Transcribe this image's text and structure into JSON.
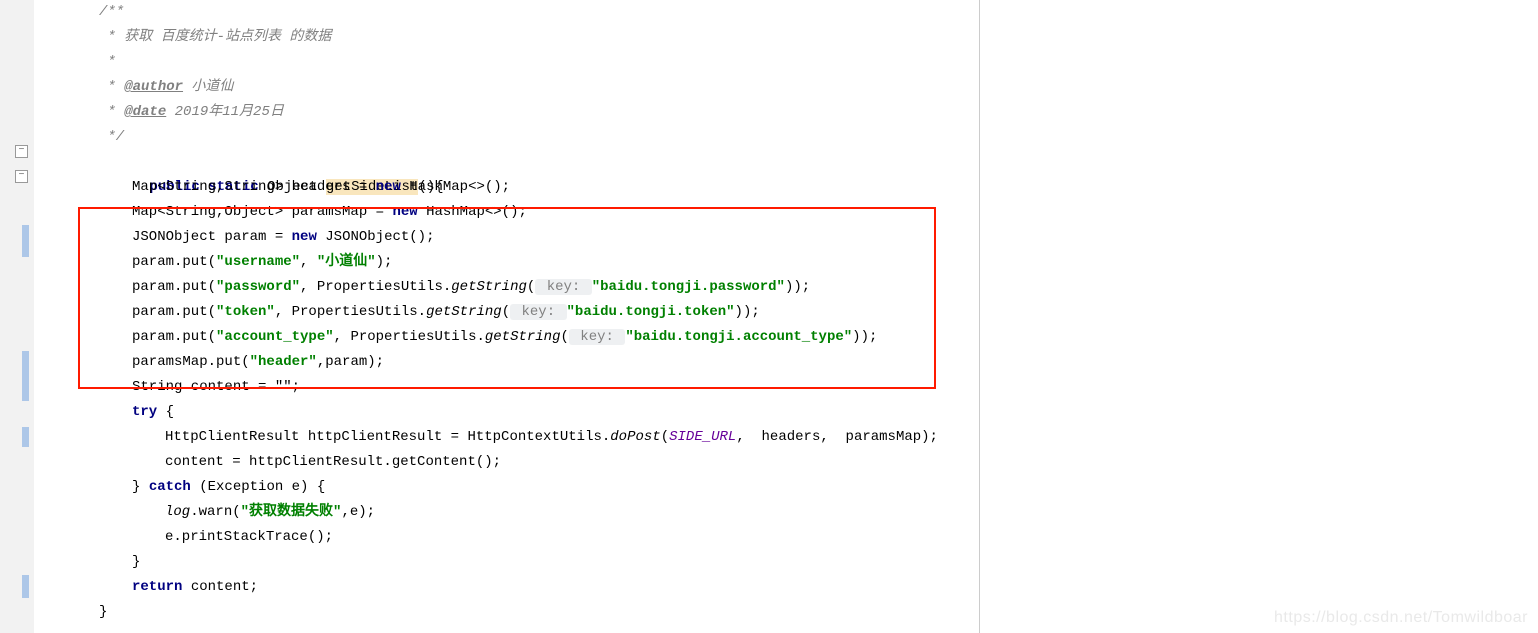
{
  "doc": {
    "l1": "/**",
    "l2_prefix": " * ",
    "l2_text": "获取 百度统计-站点列表 的数据",
    "l3": " *",
    "l4_prefix": " * ",
    "l4_tag": "@author",
    "l4_after": " 小道仙",
    "l5_prefix": " * ",
    "l5_tag": "@date",
    "l5_after": " 2019年11月25日",
    "l6": " */"
  },
  "code": {
    "sig_kw1": "public",
    "sig_kw2": "static",
    "sig_rest1": " Object ",
    "sig_method": "getSideList",
    "sig_rest2": "(){",
    "headers_a": "Map<String,String> headers = ",
    "headers_kw": "new",
    "headers_b": " HashMap<>();",
    "pmap_a": "Map<String,Object> paramsMap = ",
    "pmap_kw": "new",
    "pmap_b": " HashMap<>();",
    "jo_a": "JSONObject param = ",
    "jo_kw": "new",
    "jo_b": " JSONObject();",
    "user_a": "param.put(",
    "user_s1": "\"username\"",
    "user_mid": ", ",
    "user_s2": "\"小道仙\"",
    "user_end": ");",
    "pw_a": "param.put(",
    "pw_s1": "\"password\"",
    "pw_mid": ", PropertiesUtils.",
    "pw_em": "getString",
    "pw_open": "(",
    "pw_hint": " key: ",
    "pw_s2": "\"baidu.tongji.password\"",
    "pw_end": "));",
    "tk_a": "param.put(",
    "tk_s1": "\"token\"",
    "tk_mid": ", PropertiesUtils.",
    "tk_em": "getString",
    "tk_open": "(",
    "tk_hint": " key: ",
    "tk_s2": "\"baidu.tongji.token\"",
    "tk_end": "));",
    "ac_a": "param.put(",
    "ac_s1": "\"account_type\"",
    "ac_mid": ", PropertiesUtils.",
    "ac_em": "getString",
    "ac_open": "(",
    "ac_hint": " key: ",
    "ac_s2": "\"baidu.tongji.account_type\"",
    "ac_end": "));",
    "hdr_a": "paramsMap.put(",
    "hdr_s1": "\"header\"",
    "hdr_end": ",param);",
    "content_decl": "String content = \"\";",
    "try_kw": "try",
    "try_open": " {",
    "post_a": "HttpClientResult httpClientResult = HttpContextUtils.",
    "post_em": "doPost",
    "post_open": "(",
    "post_const": "SIDE_URL",
    "post_end": ",  headers,  paramsMap);",
    "cnt_set": "content = httpClientResult.getContent();",
    "catch_close": "} ",
    "catch_kw": "catch",
    "catch_rest": " (Exception e) {",
    "warn_a": "log",
    "warn_b": ".warn(",
    "warn_s": "\"获取数据失败\"",
    "warn_end": ",e);",
    "stk": "e.printStackTrace();",
    "catch_end": "}",
    "ret_kw": "return",
    "ret_rest": " content;",
    "method_end": "}"
  },
  "watermark": "https://blog.csdn.net/Tomwildboar"
}
